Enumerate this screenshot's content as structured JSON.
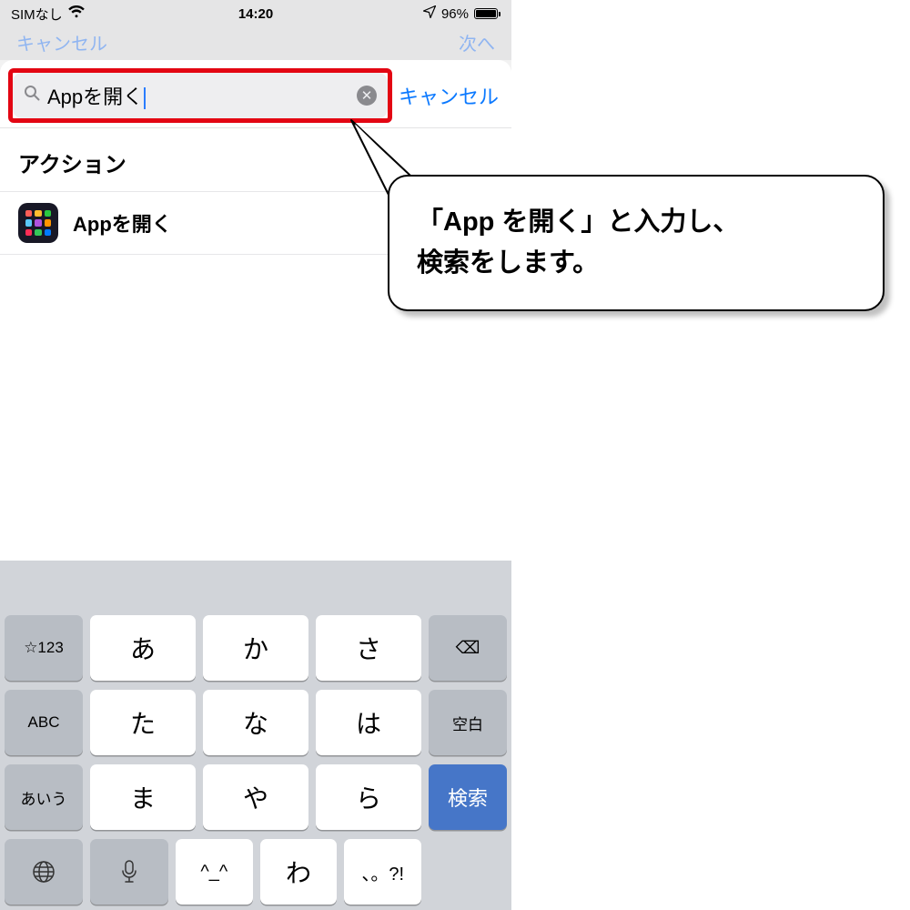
{
  "status": {
    "carrier": "SIMなし",
    "time": "14:20",
    "battery_pct": "96%"
  },
  "dim": {
    "cancel": "キャンセル",
    "next": "次へ"
  },
  "search": {
    "value": "Appを開く",
    "cancel": "キャンセル"
  },
  "section": {
    "title": "アクション"
  },
  "result": {
    "label": "Appを開く"
  },
  "keyboard": {
    "num": "☆123",
    "abc": "ABC",
    "kana": "あいう",
    "rows": [
      [
        "あ",
        "か",
        "さ"
      ],
      [
        "た",
        "な",
        "は"
      ],
      [
        "ま",
        "や",
        "ら"
      ],
      [
        "^_^",
        "わ",
        "、。?!"
      ]
    ],
    "backspace": "⌫",
    "space": "空白",
    "search": "検索"
  },
  "callout": {
    "line1": "「App を開く」と入力し、",
    "line2": "検索をします。"
  },
  "icon_colors": [
    "#ff5e57",
    "#ffbd2e",
    "#29c940",
    "#5ac8fa",
    "#af52de",
    "#ff9500",
    "#ff2d55",
    "#34c759",
    "#007aff"
  ]
}
